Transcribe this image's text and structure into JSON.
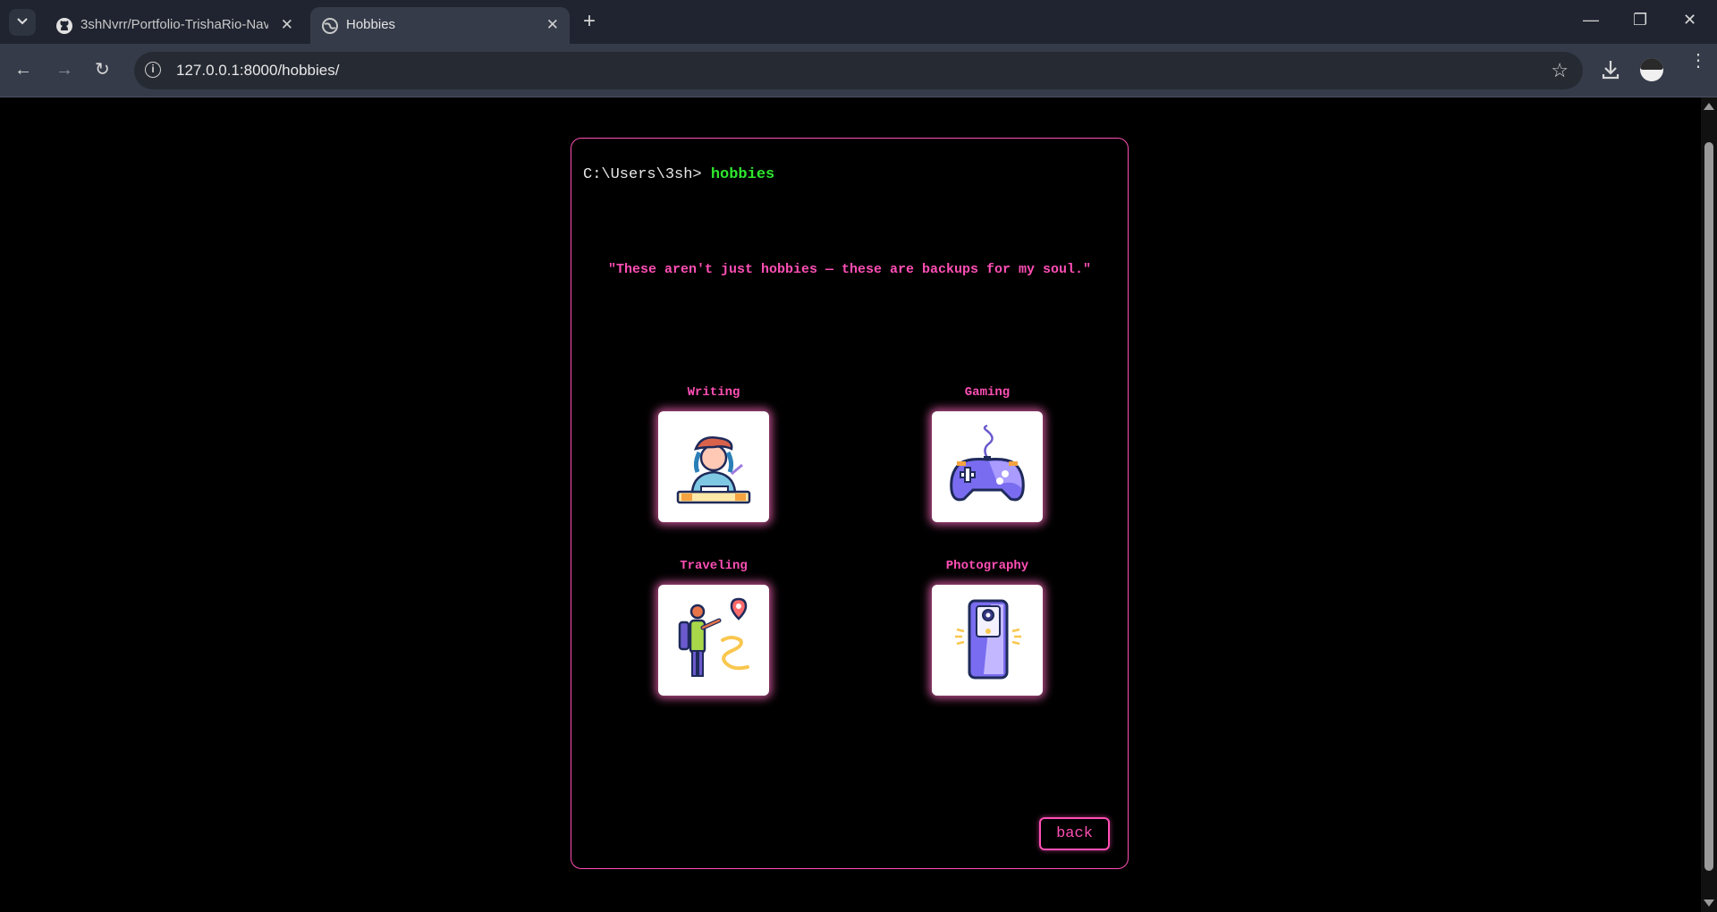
{
  "browser": {
    "tabs": [
      {
        "title": "3shNvrr/Portfolio-TrishaRio-Nav",
        "icon": "github-icon"
      },
      {
        "title": "Hobbies",
        "icon": "globe-icon"
      }
    ],
    "url": "127.0.0.1:8000/hobbies/"
  },
  "terminal": {
    "prompt": "C:\\Users\\3sh> ",
    "command": "hobbies",
    "quote": "\"These aren't just hobbies — these are backups for my soul.\"",
    "hobbies": [
      {
        "label": "Writing",
        "icon": "writer-icon"
      },
      {
        "label": "Gaming",
        "icon": "gamepad-icon"
      },
      {
        "label": "Traveling",
        "icon": "traveler-icon"
      },
      {
        "label": "Photography",
        "icon": "phone-camera-icon"
      }
    ],
    "back_label": "back"
  },
  "colors": {
    "accent": "#ff4fb5",
    "command": "#2ee62e",
    "background": "#000000"
  }
}
